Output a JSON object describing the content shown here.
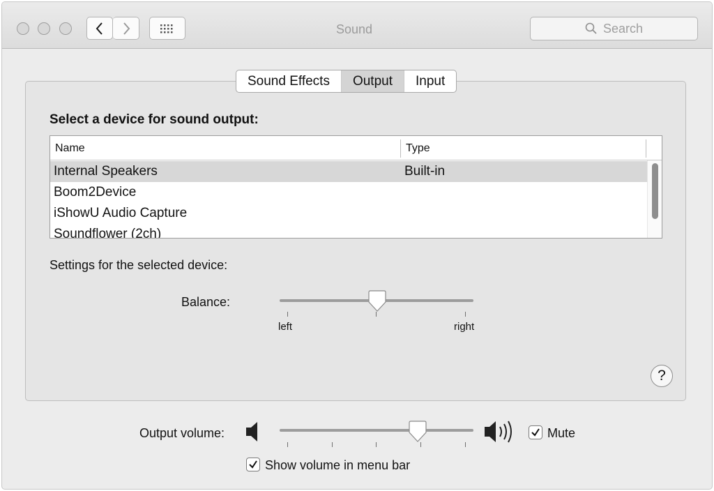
{
  "window": {
    "title": "Sound"
  },
  "search": {
    "placeholder": "Search"
  },
  "tabs": [
    {
      "label": "Sound Effects",
      "active": false
    },
    {
      "label": "Output",
      "active": true
    },
    {
      "label": "Input",
      "active": false
    }
  ],
  "main": {
    "heading": "Select a device for sound output:",
    "table": {
      "columns": [
        "Name",
        "Type"
      ],
      "rows": [
        {
          "name": "Internal Speakers",
          "type": "Built-in",
          "selected": true
        },
        {
          "name": "Boom2Device",
          "type": ""
        },
        {
          "name": "iShowU Audio Capture",
          "type": ""
        },
        {
          "name": "Soundflower (2ch)",
          "type": ""
        }
      ]
    },
    "settings_label": "Settings for the selected device:",
    "balance": {
      "label": "Balance:",
      "left_label": "left",
      "right_label": "right",
      "value_fraction": 0.5
    },
    "help_label": "?"
  },
  "bottom": {
    "output_volume_label": "Output volume:",
    "volume_fraction": 0.73,
    "mute_label": "Mute",
    "mute_checked": true,
    "show_volume_label": "Show volume in menu bar",
    "show_volume_checked": true
  },
  "icons": [
    "close-icon",
    "minimize-icon",
    "zoom-icon",
    "back-icon",
    "forward-icon",
    "grid-icon",
    "search-icon",
    "speaker-low-icon",
    "speaker-high-icon",
    "checkmark-icon",
    "help-icon"
  ],
  "colors": {
    "window_bg": "#ececec",
    "selected_row": "#d7d7d7",
    "active_tab": "#d4d4d4"
  }
}
